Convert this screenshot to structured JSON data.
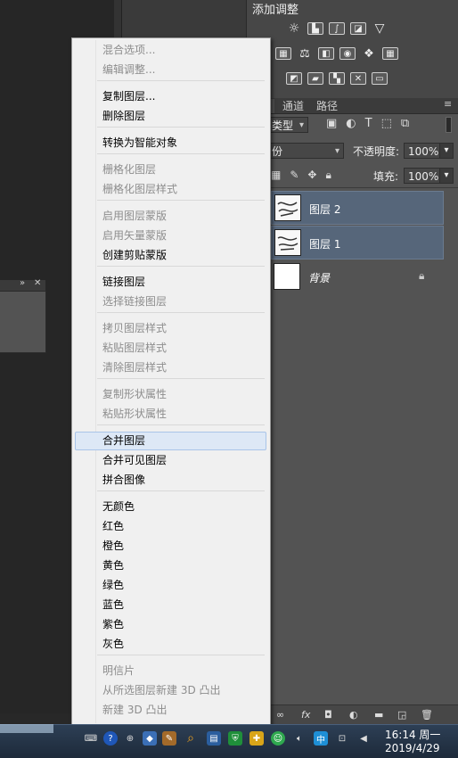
{
  "adjust_panel": {
    "title": "添加调整"
  },
  "layers_panel": {
    "tabs": [
      "通道",
      "路径"
    ],
    "filter_kind": "类型",
    "blend_mode": "份",
    "opacity_label": "不透明度:",
    "opacity_value": "100%",
    "fill_label": "填充:",
    "fill_value": "100%",
    "layers": [
      {
        "name": "图层 2",
        "selected": true
      },
      {
        "name": "图层 1",
        "selected": true
      },
      {
        "name": "背景",
        "selected": false,
        "locked": true
      }
    ],
    "bottom_icons": [
      "link-icon",
      "fx-icon",
      "mask-icon",
      "adjustment-icon",
      "folder-icon",
      "new-layer-icon",
      "trash-icon"
    ]
  },
  "context_menu": {
    "groups": [
      [
        {
          "label": "混合选项...",
          "enabled": false
        },
        {
          "label": "编辑调整...",
          "enabled": false
        }
      ],
      [
        {
          "label": "复制图层...",
          "enabled": true
        },
        {
          "label": "删除图层",
          "enabled": true
        }
      ],
      [
        {
          "label": "转换为智能对象",
          "enabled": true
        }
      ],
      [
        {
          "label": "栅格化图层",
          "enabled": false
        },
        {
          "label": "栅格化图层样式",
          "enabled": false
        }
      ],
      [
        {
          "label": "启用图层蒙版",
          "enabled": false
        },
        {
          "label": "启用矢量蒙版",
          "enabled": false
        },
        {
          "label": "创建剪贴蒙版",
          "enabled": true
        }
      ],
      [
        {
          "label": "链接图层",
          "enabled": true
        },
        {
          "label": "选择链接图层",
          "enabled": false
        }
      ],
      [
        {
          "label": "拷贝图层样式",
          "enabled": false
        },
        {
          "label": "粘贴图层样式",
          "enabled": false
        },
        {
          "label": "清除图层样式",
          "enabled": false
        }
      ],
      [
        {
          "label": "复制形状属性",
          "enabled": false
        },
        {
          "label": "粘贴形状属性",
          "enabled": false
        }
      ],
      [
        {
          "label": "合并图层",
          "enabled": true,
          "highlighted": true
        },
        {
          "label": "合并可见图层",
          "enabled": true
        },
        {
          "label": "拼合图像",
          "enabled": true
        }
      ],
      [
        {
          "label": "无颜色",
          "enabled": true
        },
        {
          "label": "红色",
          "enabled": true
        },
        {
          "label": "橙色",
          "enabled": true
        },
        {
          "label": "黄色",
          "enabled": true
        },
        {
          "label": "绿色",
          "enabled": true
        },
        {
          "label": "蓝色",
          "enabled": true
        },
        {
          "label": "紫色",
          "enabled": true
        },
        {
          "label": "灰色",
          "enabled": true
        }
      ],
      [
        {
          "label": "明信片",
          "enabled": false
        },
        {
          "label": "从所选图层新建 3D 凸出",
          "enabled": false
        },
        {
          "label": "新建 3D 凸出",
          "enabled": false
        }
      ]
    ]
  },
  "taskbar": {
    "time": "16:14 周一",
    "date": "2019/4/29"
  }
}
